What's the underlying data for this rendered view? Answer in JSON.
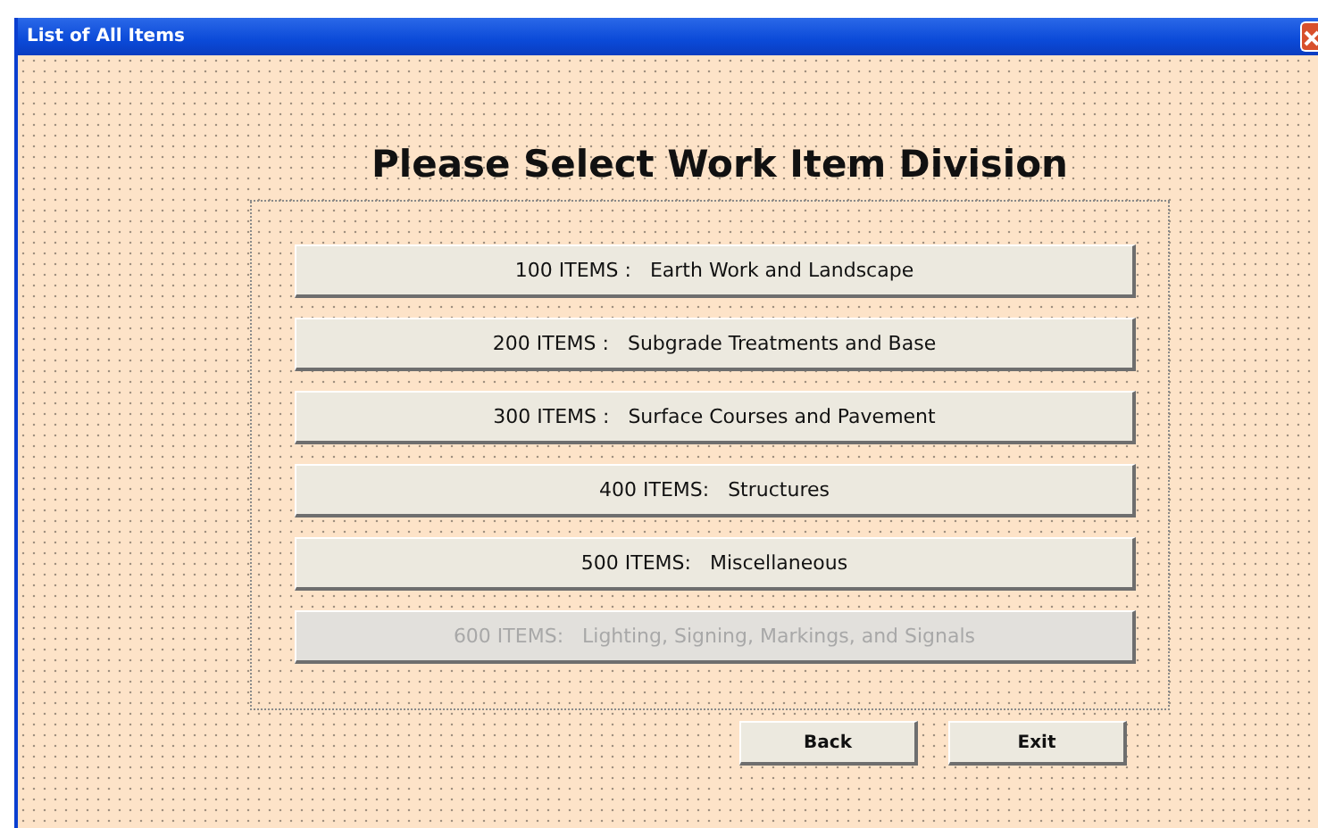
{
  "window": {
    "title": "List of All Items"
  },
  "heading": "Please Select Work Item Division",
  "divisions": [
    {
      "label": "100 ITEMS :   Earth Work and Landscape",
      "disabled": false
    },
    {
      "label": "200 ITEMS :   Subgrade Treatments and Base",
      "disabled": false
    },
    {
      "label": "300 ITEMS :   Surface Courses and Pavement",
      "disabled": false
    },
    {
      "label": "400 ITEMS:   Structures",
      "disabled": false
    },
    {
      "label": "500 ITEMS:   Miscellaneous",
      "disabled": false
    },
    {
      "label": "600 ITEMS:   Lighting, Signing, Markings, and Signals",
      "disabled": true
    }
  ],
  "buttons": [
    "Back",
    "Exit"
  ]
}
